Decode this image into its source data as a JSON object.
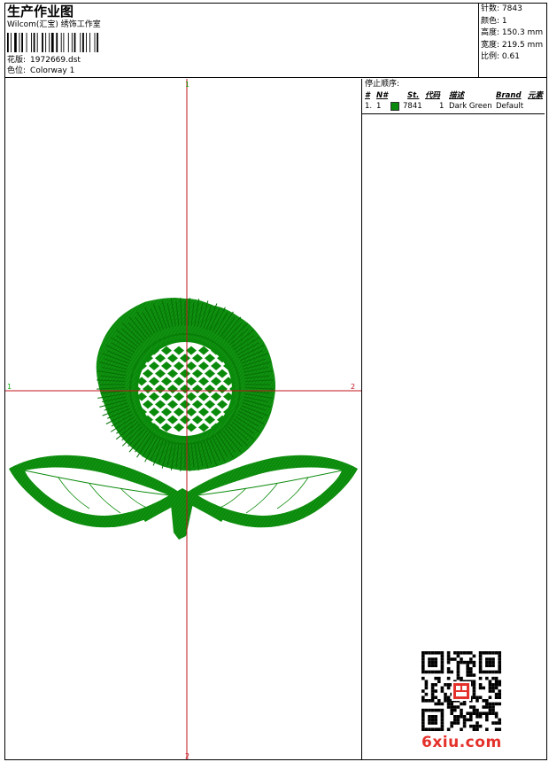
{
  "header": {
    "title": "生产作业图",
    "studio": "Wilcom(汇宝) 绣饰工作室",
    "design_label": "花版:",
    "design_value": "1972669.dst",
    "colorway_label": "色位:",
    "colorway_value": "Colorway 1"
  },
  "stats": [
    {
      "label": "针数:",
      "value": "7843"
    },
    {
      "label": "颜色:",
      "value": "1"
    },
    {
      "label": "高度:",
      "value": "150.3 mm"
    },
    {
      "label": "宽度:",
      "value": "219.5 mm"
    },
    {
      "label": "比例:",
      "value": "0.61"
    }
  ],
  "axes": {
    "top": "1",
    "bottom": "2",
    "left": "1",
    "right": "2"
  },
  "stops": {
    "title": "停止顺序:",
    "columns": [
      "#",
      "N#",
      "St.",
      "代码",
      "描述",
      "Brand",
      "元素"
    ],
    "rows": [
      {
        "num": "1.",
        "n": "1",
        "stitches": "7841",
        "code": "1",
        "desc": "Dark Green",
        "brand": "Default",
        "color": "#0a8a0a"
      }
    ]
  },
  "colors": {
    "thread": "#0a8a0a",
    "crosshair": "#c0141e",
    "axis_label": "#16b016"
  },
  "watermark": "6xiu.com"
}
